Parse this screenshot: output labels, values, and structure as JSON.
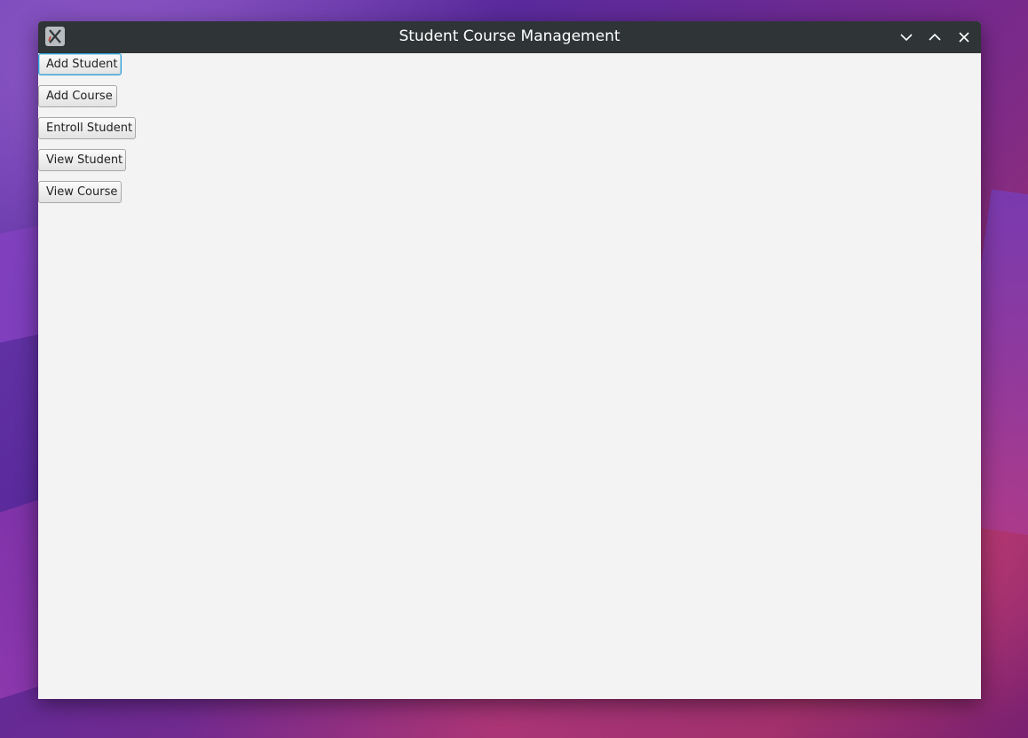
{
  "window": {
    "title": "Student Course Management",
    "icons": {
      "app": "x-app-icon",
      "minimize": "chevron-down-icon",
      "maximize": "chevron-up-icon",
      "close": "close-icon"
    }
  },
  "buttons": {
    "add_student": "Add Student",
    "add_course": "Add Course",
    "enroll_student": "Entroll Student",
    "view_student": "View Student",
    "view_course": "View Course"
  },
  "colors": {
    "titlebar": "#2f3437",
    "content_background": "#f3f3f3",
    "focus_accent": "#2a9fd6"
  }
}
